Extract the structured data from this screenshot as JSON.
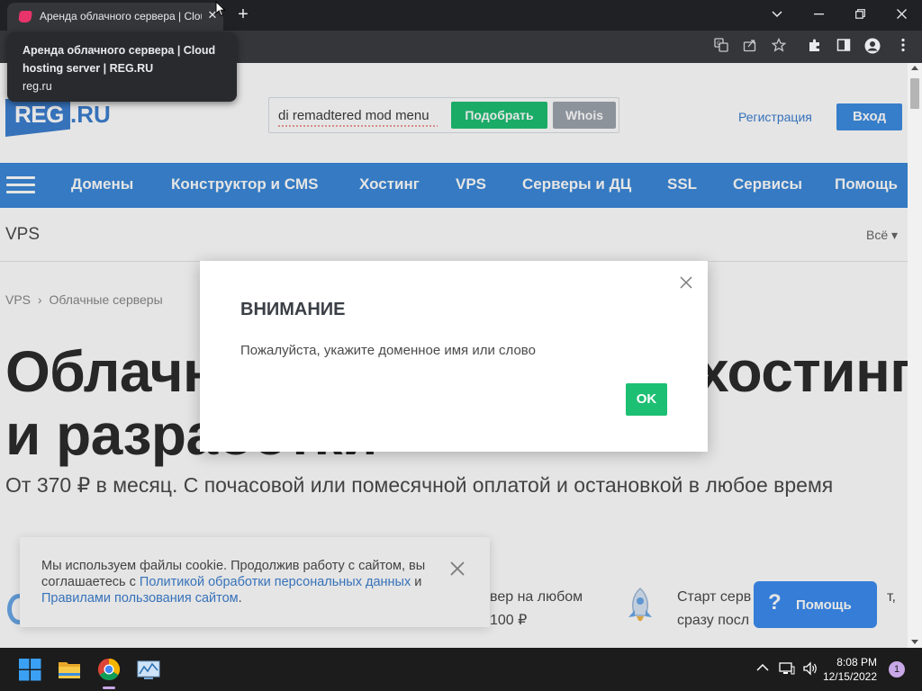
{
  "browser": {
    "tab_title": "Аренда облачного сервера | Cloud hosting server | REG.RU",
    "tooltip_title": "Аренда облачного сервера | Cloud hosting server | REG.RU",
    "tooltip_url": "reg.ru",
    "close_glyph": "✕",
    "new_tab_glyph": "+"
  },
  "site": {
    "logo_reg": "REG",
    "logo_ru": ".RU",
    "search_value": "di remadtered mod menu",
    "pick_button": "Подобрать",
    "whois_button": "Whois",
    "register_link": "Регистрация",
    "login_button": "Вход",
    "nav": [
      "Домены",
      "Конструктор и CMS",
      "Хостинг",
      "VPS",
      "Серверы и ДЦ",
      "SSL",
      "Сервисы",
      "Помощь"
    ],
    "section_title": "VPS",
    "section_all": "Всё ▾",
    "breadcrumb": [
      "VPS",
      "Облачные серверы"
    ],
    "hero_line1": "Облачные серверы для хостинга",
    "hero_line2": "и разработки",
    "hero_sub": "От 370 ₽ в месяц. С почасовой или помесячной оплатой и остановкой в любое время",
    "feature_mid_1": "вер на любом",
    "feature_mid_2": "100 ₽",
    "feature_right_1": "Старт серв",
    "feature_right_1b": "т,",
    "feature_right_2": "сразу посл"
  },
  "cookie": {
    "text_1": "Мы используем файлы cookie. Продолжив работу с сайтом, вы соглашаетесь с ",
    "link_1": "Политикой обработки персональных данных",
    "and": " и ",
    "link_2": "Правилами пользования сайтом",
    "end": "."
  },
  "help": {
    "glyph": "?",
    "label": "Помощь"
  },
  "modal": {
    "title": "ВНИМАНИЕ",
    "message": "Пожалуйста, укажите доменное имя или слово",
    "ok": "OK"
  },
  "taskbar": {
    "time": "8:08 PM",
    "date": "12/15/2022",
    "notifications": "1"
  },
  "colors": {
    "brand_blue": "#3b88d8",
    "green": "#1dbf73",
    "help_blue": "#3b8cf0"
  }
}
